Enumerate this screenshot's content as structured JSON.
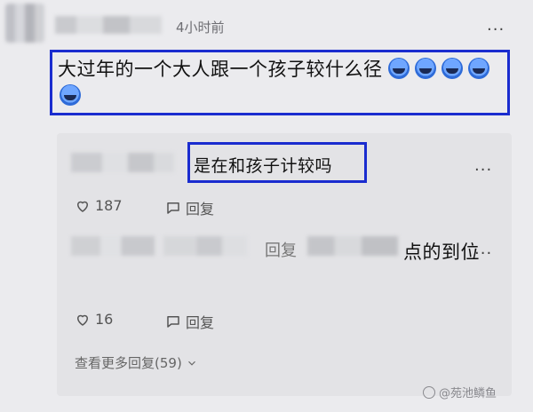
{
  "comment": {
    "time": "4小时前",
    "more_label": "...",
    "text": "大过年的一个大人跟一个孩子较什么径",
    "emoji_count": 5,
    "emoji_icon": "laughing-tears-emoji-icon"
  },
  "replies": [
    {
      "text": "是在和孩子计较吗",
      "more_label": "...",
      "likes": "187",
      "reply_label": "回复"
    },
    {
      "reply_word": "回复",
      "text": "点的到位",
      "more_label": "...",
      "likes": "16",
      "reply_label": "回复"
    }
  ],
  "view_more": "查看更多回复(59)",
  "watermark": "@苑池鳞鱼",
  "colors": {
    "highlight_border": "#1a2ccf",
    "background": "#ebebee",
    "reply_panel": "#e3e3e6"
  }
}
